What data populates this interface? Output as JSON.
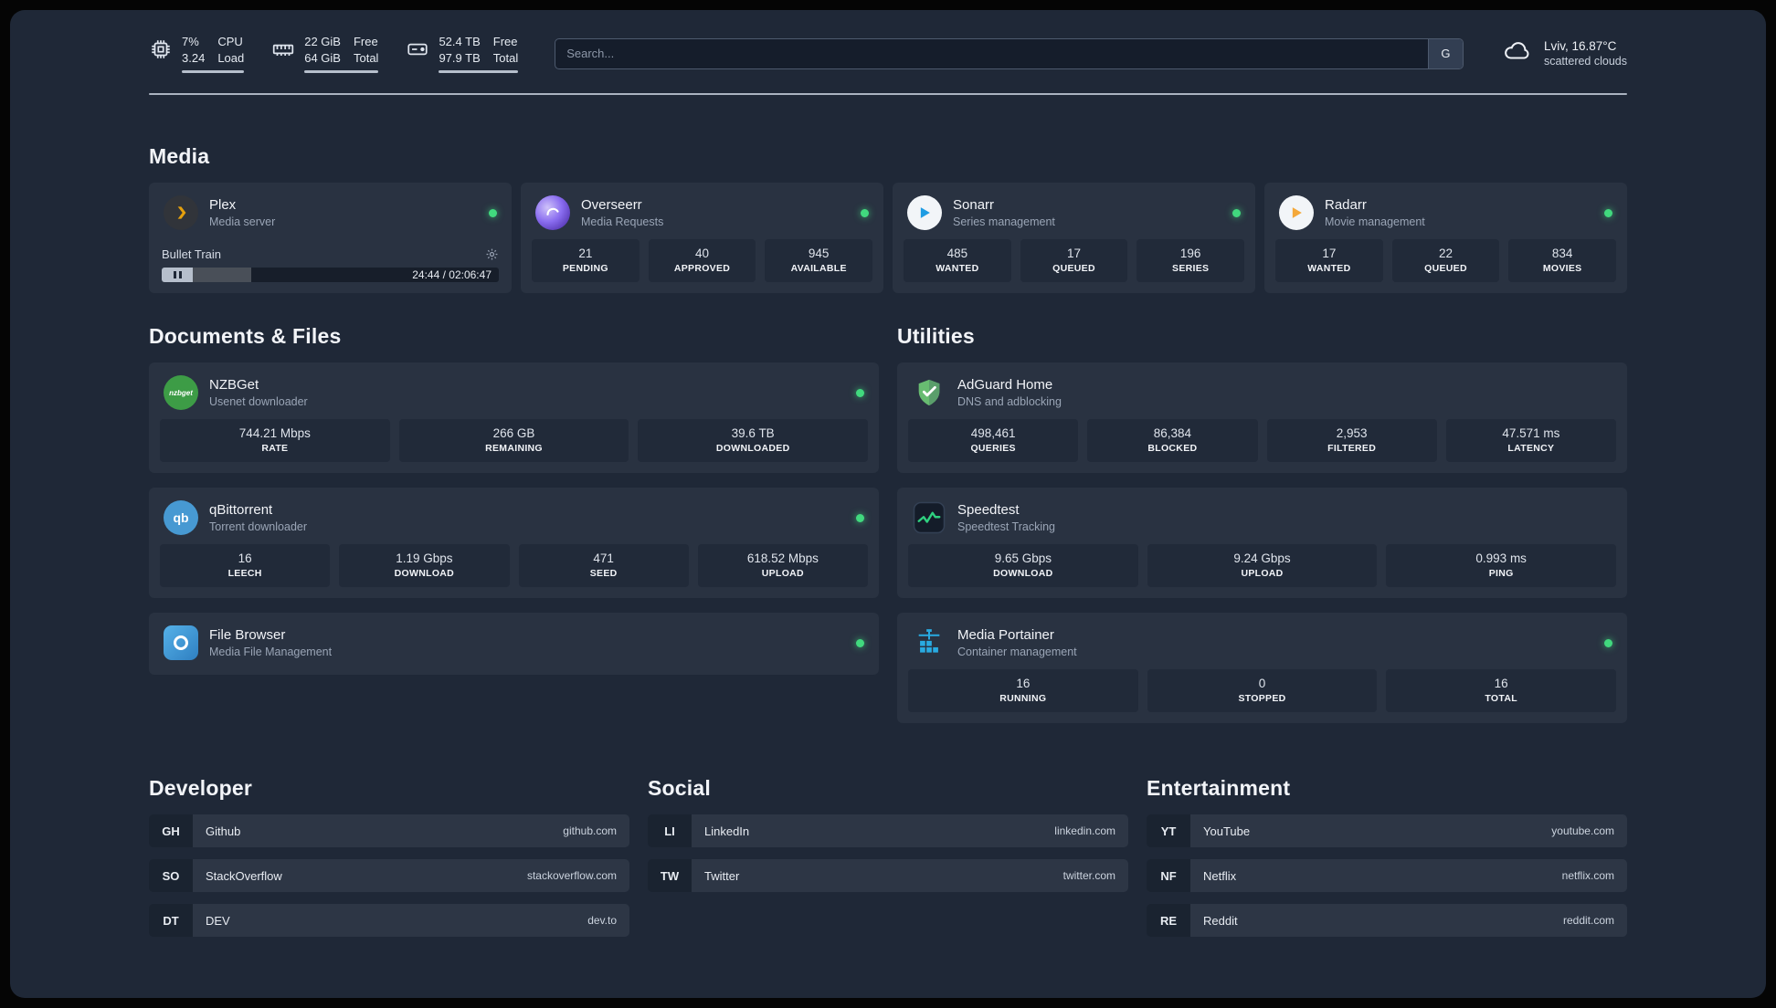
{
  "topbar": {
    "cpu": {
      "usage": "7%",
      "load": "3.24",
      "label1": "CPU",
      "label2": "Load"
    },
    "ram": {
      "free": "22 GiB",
      "total": "64 GiB",
      "label1": "Free",
      "label2": "Total"
    },
    "disk": {
      "free": "52.4 TB",
      "total": "97.9 TB",
      "label1": "Free",
      "label2": "Total"
    },
    "search": {
      "placeholder": "Search...",
      "engine": "G"
    },
    "weather": {
      "location": "Lviv, 16.87°C",
      "condition": "scattered clouds"
    }
  },
  "sections": {
    "media": "Media",
    "documents": "Documents & Files",
    "utilities": "Utilities",
    "developer": "Developer",
    "social": "Social",
    "entertainment": "Entertainment"
  },
  "media": {
    "plex": {
      "name": "Plex",
      "desc": "Media server",
      "status": "online",
      "now_playing": "Bullet Train",
      "time": "24:44 / 02:06:47",
      "progress_percent": 19
    },
    "overseerr": {
      "name": "Overseerr",
      "desc": "Media Requests",
      "status": "online",
      "stats": [
        {
          "value": "21",
          "label": "PENDING"
        },
        {
          "value": "40",
          "label": "APPROVED"
        },
        {
          "value": "945",
          "label": "AVAILABLE"
        }
      ]
    },
    "sonarr": {
      "name": "Sonarr",
      "desc": "Series management",
      "status": "online",
      "stats": [
        {
          "value": "485",
          "label": "WANTED"
        },
        {
          "value": "17",
          "label": "QUEUED"
        },
        {
          "value": "196",
          "label": "SERIES"
        }
      ]
    },
    "radarr": {
      "name": "Radarr",
      "desc": "Movie management",
      "status": "online",
      "stats": [
        {
          "value": "17",
          "label": "WANTED"
        },
        {
          "value": "22",
          "label": "QUEUED"
        },
        {
          "value": "834",
          "label": "MOVIES"
        }
      ]
    }
  },
  "documents": {
    "nzbget": {
      "name": "NZBGet",
      "desc": "Usenet downloader",
      "status": "online",
      "icon_text": "nzbget",
      "stats": [
        {
          "value": "744.21 Mbps",
          "label": "RATE"
        },
        {
          "value": "266 GB",
          "label": "REMAINING"
        },
        {
          "value": "39.6 TB",
          "label": "DOWNLOADED"
        }
      ]
    },
    "qbittorrent": {
      "name": "qBittorrent",
      "desc": "Torrent downloader",
      "status": "online",
      "icon_text": "qb",
      "stats": [
        {
          "value": "16",
          "label": "LEECH"
        },
        {
          "value": "1.19 Gbps",
          "label": "DOWNLOAD"
        },
        {
          "value": "471",
          "label": "SEED"
        },
        {
          "value": "618.52 Mbps",
          "label": "UPLOAD"
        }
      ]
    },
    "filebrowser": {
      "name": "File Browser",
      "desc": "Media File Management",
      "status": "online"
    }
  },
  "utilities": {
    "adguard": {
      "name": "AdGuard Home",
      "desc": "DNS and adblocking",
      "stats": [
        {
          "value": "498,461",
          "label": "QUERIES"
        },
        {
          "value": "86,384",
          "label": "BLOCKED"
        },
        {
          "value": "2,953",
          "label": "FILTERED"
        },
        {
          "value": "47.571 ms",
          "label": "LATENCY"
        }
      ]
    },
    "speedtest": {
      "name": "Speedtest",
      "desc": "Speedtest Tracking",
      "stats": [
        {
          "value": "9.65 Gbps",
          "label": "DOWNLOAD"
        },
        {
          "value": "9.24 Gbps",
          "label": "UPLOAD"
        },
        {
          "value": "0.993 ms",
          "label": "PING"
        }
      ]
    },
    "portainer": {
      "name": "Media Portainer",
      "desc": "Container management",
      "status": "online",
      "stats": [
        {
          "value": "16",
          "label": "RUNNING"
        },
        {
          "value": "0",
          "label": "STOPPED"
        },
        {
          "value": "16",
          "label": "TOTAL"
        }
      ]
    }
  },
  "bookmarks": {
    "developer": [
      {
        "abbr": "GH",
        "name": "Github",
        "url": "github.com"
      },
      {
        "abbr": "SO",
        "name": "StackOverflow",
        "url": "stackoverflow.com"
      },
      {
        "abbr": "DT",
        "name": "DEV",
        "url": "dev.to"
      }
    ],
    "social": [
      {
        "abbr": "LI",
        "name": "LinkedIn",
        "url": "linkedin.com"
      },
      {
        "abbr": "TW",
        "name": "Twitter",
        "url": "twitter.com"
      }
    ],
    "entertainment": [
      {
        "abbr": "YT",
        "name": "YouTube",
        "url": "youtube.com"
      },
      {
        "abbr": "NF",
        "name": "Netflix",
        "url": "netflix.com"
      },
      {
        "abbr": "RE",
        "name": "Reddit",
        "url": "reddit.com"
      }
    ]
  },
  "colors": {
    "status_online": "#41d97e",
    "plex_amber": "#e5a00d",
    "accent_green": "#2fd180",
    "portainer_blue": "#29aae1"
  }
}
